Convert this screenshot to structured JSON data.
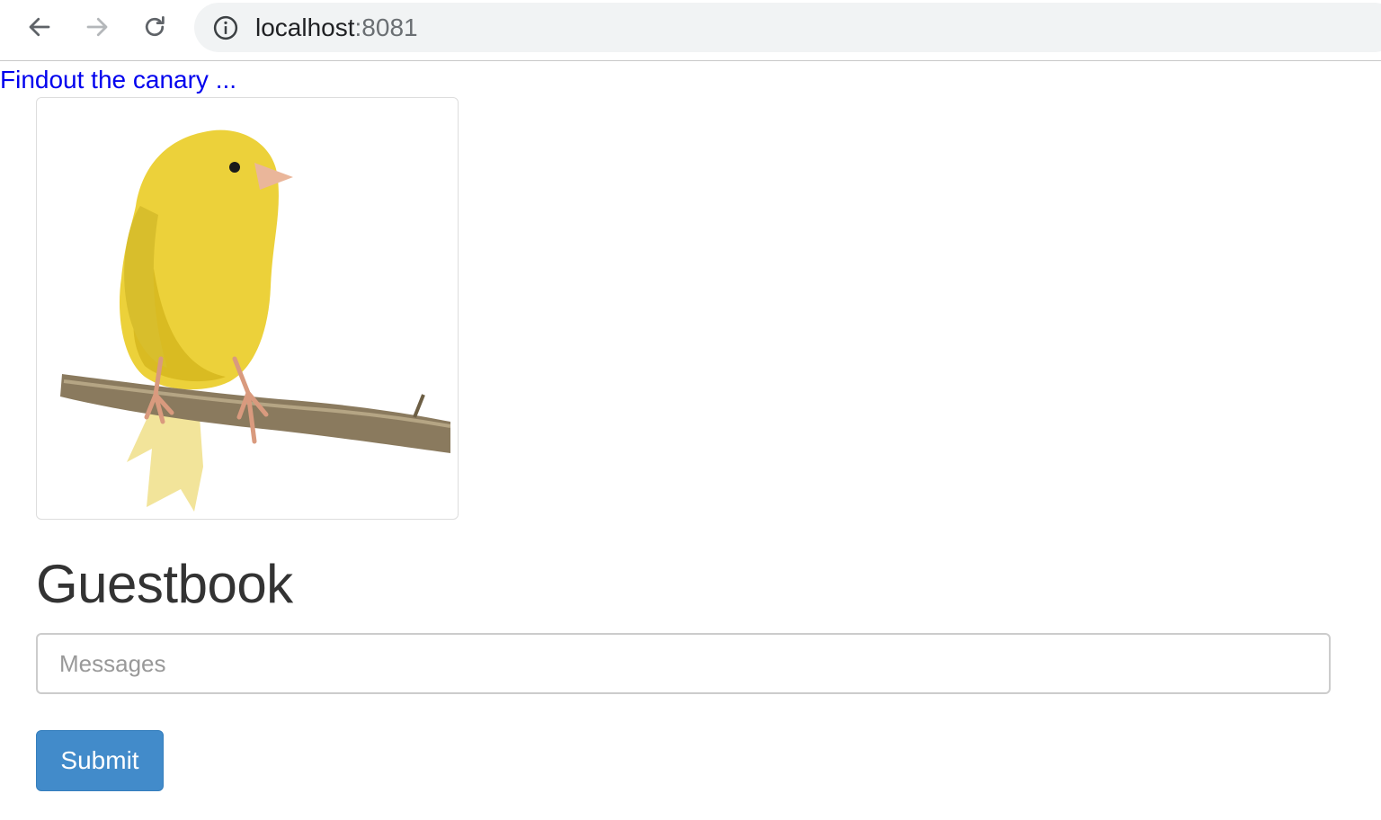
{
  "browser": {
    "url_host": "localhost",
    "url_port": ":8081",
    "icons": {
      "back": "arrow-left-icon",
      "forward": "arrow-right-icon",
      "reload": "reload-icon",
      "site_info": "info-icon"
    }
  },
  "page": {
    "top_link": "Findout the canary ...",
    "image": "yellow canary perched on branch",
    "heading": "Guestbook",
    "message_input": {
      "placeholder": "Messages",
      "value": ""
    },
    "submit_label": "Submit"
  },
  "colors": {
    "link": "#0000ee",
    "button": "#428bca",
    "heading": "#333333"
  }
}
